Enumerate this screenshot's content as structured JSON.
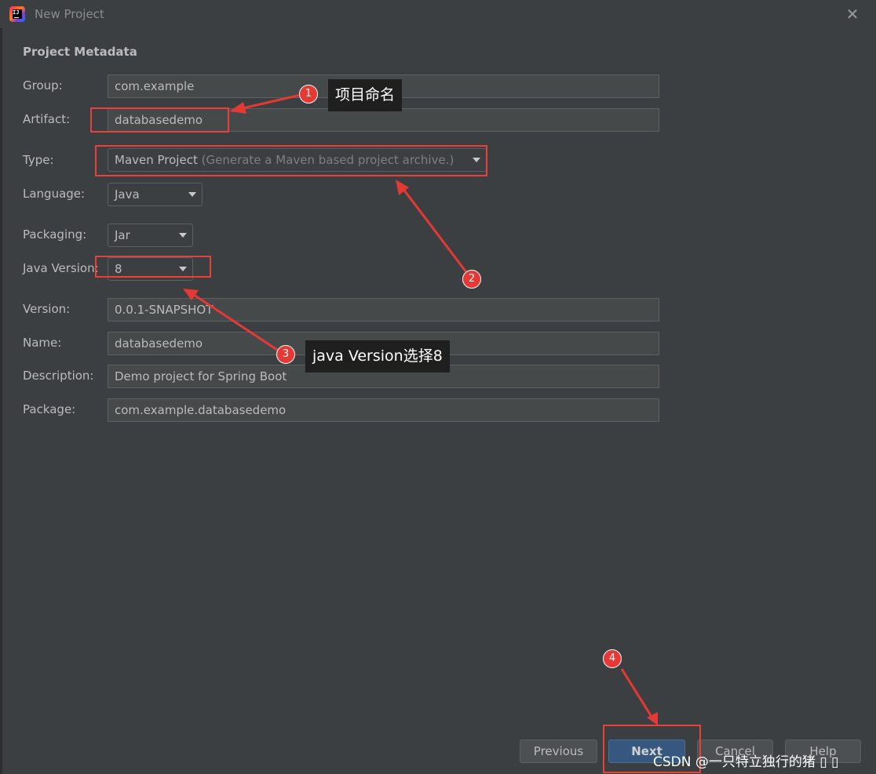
{
  "window": {
    "title": "New Project",
    "close_glyph": "✕",
    "app_icon_text": "IJ"
  },
  "section_title": "Project Metadata",
  "fields": {
    "group": {
      "label": "Group:",
      "value": "com.example"
    },
    "artifact": {
      "label": "Artifact:",
      "value": "databasedemo"
    },
    "type": {
      "label": "Type:",
      "value": "Maven Project",
      "hint": "(Generate a Maven based project archive.)"
    },
    "language": {
      "label": "Language:",
      "value": "Java"
    },
    "packaging": {
      "label": "Packaging:",
      "value": "Jar"
    },
    "java_version": {
      "label": "Java Version:",
      "value": "8"
    },
    "version": {
      "label": "Version:",
      "value": "0.0.1-SNAPSHOT"
    },
    "name": {
      "label": "Name:",
      "value": "databasedemo"
    },
    "description": {
      "label": "Description:",
      "value": "Demo project for Spring Boot"
    },
    "package": {
      "label": "Package:",
      "value": "com.example.databasedemo"
    }
  },
  "buttons": {
    "previous": "Previous",
    "next": "Next",
    "cancel": "Cancel",
    "help": "Help"
  },
  "annotations": {
    "badge1": "1",
    "badge2": "2",
    "badge3": "3",
    "badge4": "4",
    "tip1": "项目命名",
    "tip3": "java Version选择8",
    "color": "#e53935"
  },
  "watermark": "CSDN @一只特立独行的猪 ▯ ▯"
}
